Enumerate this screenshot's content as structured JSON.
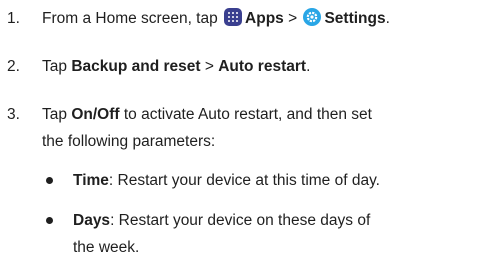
{
  "steps": [
    {
      "number": "1.",
      "text_a": "From a Home screen, tap ",
      "apps_label": "Apps",
      "separator": " > ",
      "settings_label": "Settings",
      "end": "."
    },
    {
      "number": "2.",
      "text_a": "Tap ",
      "backup_label": "Backup and reset",
      "separator": " > ",
      "auto_label": "Auto restart",
      "end": "."
    },
    {
      "number": "3.",
      "text_a": "Tap ",
      "onoff_label": "On/Off",
      "line1_rest": " to activate Auto restart, and then set",
      "line2": "the following parameters:"
    }
  ],
  "bullets": [
    {
      "term": "Time",
      "line1_rest": ": Restart your device at this time of day."
    },
    {
      "term": "Days",
      "line1_rest": ": Restart your device on these days of",
      "line2": "the week."
    }
  ],
  "icons": {
    "apps": "apps-grid-icon",
    "settings": "settings-gear-icon"
  },
  "colors": {
    "apps_icon_bg": "#3a3f8f",
    "settings_icon_bg": "#29a6e6"
  }
}
